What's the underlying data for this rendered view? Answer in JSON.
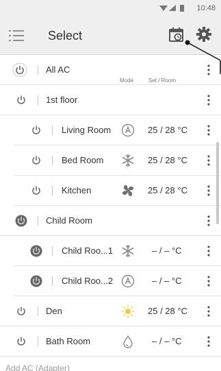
{
  "status": {
    "time": "10:48"
  },
  "app_bar": {
    "title": "Select"
  },
  "header": {
    "mode_label": "Mode",
    "set_room_label": "Set / Room"
  },
  "rows": [
    {
      "name": "All AC"
    },
    {
      "name": "1st floor"
    },
    {
      "name": "Living Room",
      "mode": "auto-mode-icon",
      "temp": "25 / 28 °C"
    },
    {
      "name": "Bed Room",
      "mode": "snowflake-icon",
      "temp": "25 / 28 °C"
    },
    {
      "name": "Kitchen",
      "mode": "fan-icon",
      "temp": "25 / 28 °C"
    },
    {
      "name": "Child Room"
    },
    {
      "name": "Child Roo...1",
      "mode": "snowflake-icon",
      "temp": "– / –  °C"
    },
    {
      "name": "Child Roo...2",
      "mode": "auto-mode-icon",
      "temp": "– / –  °C"
    },
    {
      "name": "Den",
      "mode": "sun-icon",
      "temp": "25 / 28 °C"
    },
    {
      "name": "Bath Room",
      "mode": "droplet-icon",
      "temp": "– / –  °C"
    }
  ],
  "footer": {
    "add_ac": "Add AC (Adapter)"
  },
  "colors": {
    "bar_bg": "#efefef",
    "icon_gray": "#555555",
    "power_on": "#666666",
    "mode_gray": "#8a8a8a",
    "sun_yellow": "#f2c94c"
  }
}
